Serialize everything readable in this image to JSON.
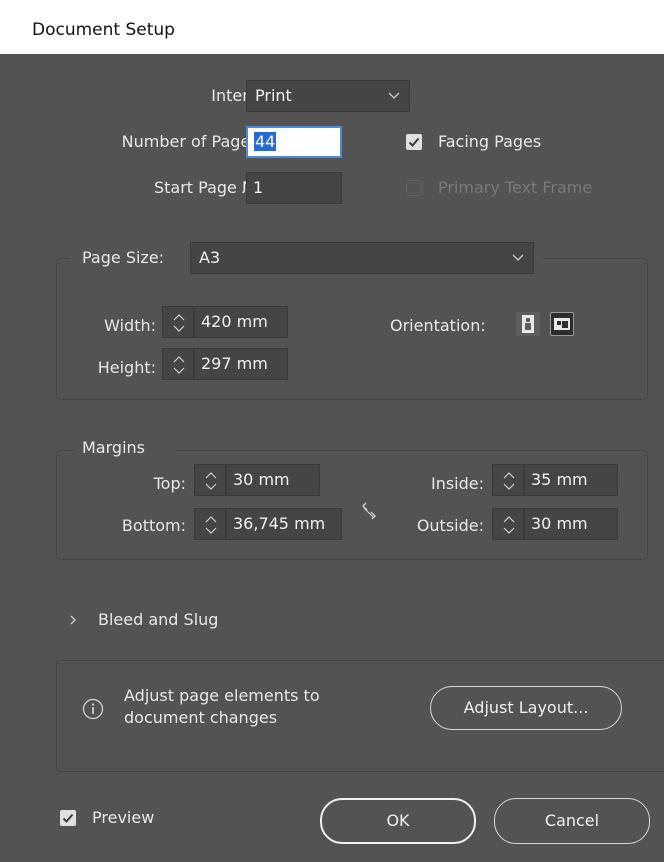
{
  "window": {
    "title": "Document Setup"
  },
  "intent": {
    "label": "Intent:",
    "value": "Print"
  },
  "pages": {
    "number_label": "Number of Pages:",
    "number_value": "44",
    "start_label": "Start Page №:",
    "start_value": "1",
    "facing_pages_label": "Facing Pages",
    "facing_pages_checked": true,
    "primary_text_frame_label": "Primary Text Frame",
    "primary_text_frame_checked": false
  },
  "page_size": {
    "label": "Page Size:",
    "value": "A3",
    "width_label": "Width:",
    "width_value": "420 mm",
    "height_label": "Height:",
    "height_value": "297 mm",
    "orientation_label": "Orientation:",
    "orientation_selected": "landscape"
  },
  "margins": {
    "legend": "Margins",
    "top_label": "Top:",
    "top_value": "30 mm",
    "bottom_label": "Bottom:",
    "bottom_value": "36,745 mm",
    "inside_label": "Inside:",
    "inside_value": "35 mm",
    "outside_label": "Outside:",
    "outside_value": "30 mm",
    "linked": false
  },
  "bleed": {
    "label": "Bleed and Slug",
    "expanded": false
  },
  "adjust": {
    "text_line1": "Adjust page elements to",
    "text_line2": "document changes",
    "button": "Adjust Layout..."
  },
  "footer": {
    "preview_label": "Preview",
    "preview_checked": true,
    "ok": "OK",
    "cancel": "Cancel"
  },
  "colors": {
    "dialog_bg": "#535353",
    "field_bg": "#454545",
    "focus": "#4c8bdc",
    "selection": "#2a6ad0"
  }
}
